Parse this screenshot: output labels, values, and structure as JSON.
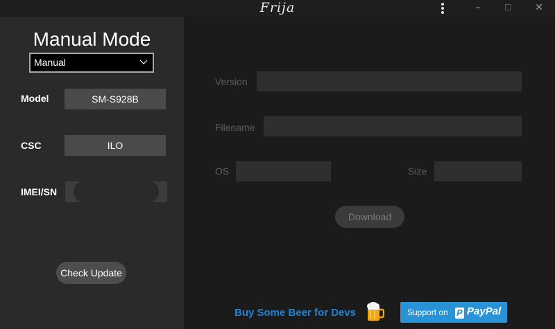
{
  "window": {
    "title": "Frija",
    "controls": {
      "menu": "more-vertical-icon",
      "minimize": "–",
      "maximize": "maximize-icon",
      "close": "✕"
    }
  },
  "left": {
    "mode_title": "Manual Mode",
    "mode_select": {
      "value": "Manual"
    },
    "fields": {
      "model": {
        "label": "Model",
        "value": "SM-S928B"
      },
      "csc": {
        "label": "CSC",
        "value": "ILO"
      },
      "imei": {
        "label": "IMEI/SN",
        "value": ""
      }
    },
    "check_update_label": "Check Update"
  },
  "right": {
    "version_label": "Version",
    "filename_label": "Filename",
    "os_label": "OS",
    "size_label": "Size",
    "download_label": "Download",
    "beer_text": "Buy Some Beer for Devs",
    "paypal": {
      "support_text": "Support on",
      "brand": "PayPal"
    }
  },
  "colors": {
    "accent": "#1e84d6",
    "paypal": "#2993d8",
    "left_panel": "#2a2a2a",
    "right_panel": "#1b1b1b"
  }
}
